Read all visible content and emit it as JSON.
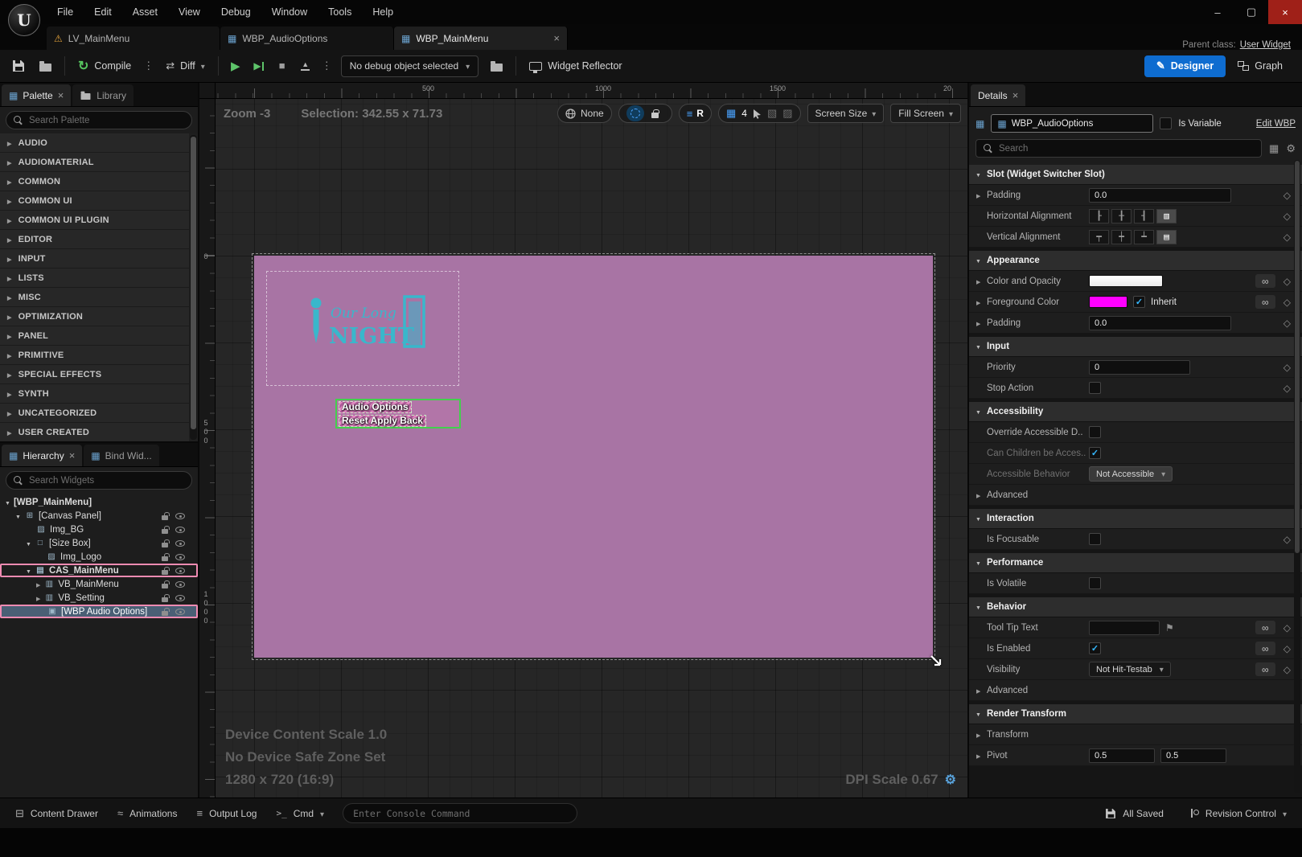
{
  "window": {
    "minimize_icon": "–",
    "maximize_icon": "▢",
    "close_icon": "×",
    "logo_glyph": "U"
  },
  "menubar": {
    "items": [
      "File",
      "Edit",
      "Asset",
      "View",
      "Debug",
      "Window",
      "Tools",
      "Help"
    ]
  },
  "tabbar": {
    "tabs": [
      {
        "label": "LV_MainMenu"
      },
      {
        "label": "WBP_AudioOptions"
      },
      {
        "label": "WBP_MainMenu"
      }
    ],
    "close_icon": "×",
    "parent_class_label": "Parent class:",
    "parent_class_value": "User Widget"
  },
  "toolbar": {
    "compile_label": "Compile",
    "diff_label": "Diff",
    "debug_dropdown_label": "No debug object selected",
    "widget_reflector_label": "Widget Reflector",
    "designer_label": "Designer",
    "graph_label": "Graph"
  },
  "palette": {
    "tab_label": "Palette",
    "library_tab_label": "Library",
    "search_placeholder": "Search Palette",
    "categories": [
      "AUDIO",
      "AUDIOMATERIAL",
      "COMMON",
      "COMMON UI",
      "COMMON UI PLUGIN",
      "EDITOR",
      "INPUT",
      "LISTS",
      "MISC",
      "OPTIMIZATION",
      "PANEL",
      "PRIMITIVE",
      "SPECIAL EFFECTS",
      "SYNTH",
      "UNCATEGORIZED",
      "USER CREATED"
    ]
  },
  "hierarchy": {
    "tab_label": "Hierarchy",
    "bind_tab_label": "Bind Wid...",
    "search_placeholder": "Search Widgets",
    "items": [
      {
        "label": "[WBP_MainMenu]"
      },
      {
        "label": "[Canvas Panel]"
      },
      {
        "label": "Img_BG"
      },
      {
        "label": "[Size Box]"
      },
      {
        "label": "Img_Logo"
      },
      {
        "label": "CAS_MainMenu"
      },
      {
        "label": "VB_MainMenu"
      },
      {
        "label": "VB_Setting"
      },
      {
        "label": "[WBP Audio Options]"
      }
    ]
  },
  "viewport": {
    "zoom_label": "Zoom -3",
    "selection_label": "Selection: 342.55 x 71.73",
    "none_label": "None",
    "r_label": "R",
    "snap_value": "4",
    "screen_size_label": "Screen Size",
    "fill_screen_label": "Fill Screen",
    "ruler_top": [
      "500",
      "1000",
      "1500",
      "20"
    ],
    "ruler_left": [
      "0",
      "500",
      "1000"
    ],
    "canvas": {
      "logo_line1": "Our Long",
      "logo_line2": "NIGHT",
      "menu_row1": "Audio Options",
      "menu_row2": "Reset Apply Back"
    },
    "overlay": {
      "device_scale": "Device Content Scale 1.0",
      "safe_zone": "No Device Safe Zone Set",
      "resolution": "1280 x 720 (16:9)",
      "dpi": "DPI Scale 0.67"
    }
  },
  "details": {
    "tab_label": "Details",
    "name_value": "WBP_AudioOptions",
    "is_variable_label": "Is Variable",
    "edit_link_label": "Edit WBP",
    "search_placeholder": "Search",
    "sections": {
      "slot": "Slot (Widget Switcher Slot)",
      "appearance": "Appearance",
      "input": "Input",
      "accessibility": "Accessibility",
      "interaction": "Interaction",
      "performance": "Performance",
      "behavior": "Behavior",
      "render_transform": "Render Transform"
    },
    "rows": {
      "slot_padding": {
        "label": "Padding",
        "value": "0.0"
      },
      "h_align": {
        "label": "Horizontal Alignment"
      },
      "v_align": {
        "label": "Vertical Alignment"
      },
      "color_opacity": {
        "label": "Color and Opacity"
      },
      "foreground_color": {
        "label": "Foreground Color",
        "inherit": "Inherit"
      },
      "appearance_padding": {
        "label": "Padding",
        "value": "0.0"
      },
      "priority": {
        "label": "Priority",
        "value": "0"
      },
      "stop_action": {
        "label": "Stop Action"
      },
      "override_accessible": {
        "label": "Override Accessible D.."
      },
      "can_children": {
        "label": "Can Children be Acces.."
      },
      "accessible_behavior": {
        "label": "Accessible Behavior",
        "value": "Not Accessible"
      },
      "accessibility_advanced": {
        "label": "Advanced"
      },
      "is_focusable": {
        "label": "Is Focusable"
      },
      "is_volatile": {
        "label": "Is Volatile"
      },
      "tooltip": {
        "label": "Tool Tip Text"
      },
      "is_enabled": {
        "label": "Is Enabled"
      },
      "visibility": {
        "label": "Visibility",
        "value": "Not Hit-Testab"
      },
      "behavior_advanced": {
        "label": "Advanced"
      },
      "transform": {
        "label": "Transform"
      },
      "pivot": {
        "label": "Pivot",
        "x": "0.5",
        "y": "0.5"
      }
    }
  },
  "statusbar": {
    "content_drawer": "Content Drawer",
    "animations": "Animations",
    "output_log": "Output Log",
    "cmd_label": "Cmd",
    "cmd_icon_glyph": ">_",
    "console_placeholder": "Enter Console Command",
    "all_saved": "All Saved",
    "revision_control": "Revision Control"
  },
  "icons": {
    "warning": "⚠",
    "widget_blueprint": "▦",
    "gear": "⚙",
    "bind_diamond": "◇",
    "chain_link": "∞",
    "checkmark": "✓"
  },
  "colors": {
    "accent_blue": "#0e6cd0",
    "selection_green": "#43d04d",
    "highlight_pink": "#f08bb2",
    "canvas_purple": "#a874a4",
    "logo_teal": "#39b7cb",
    "foreground_magenta": "#ff00ff"
  }
}
